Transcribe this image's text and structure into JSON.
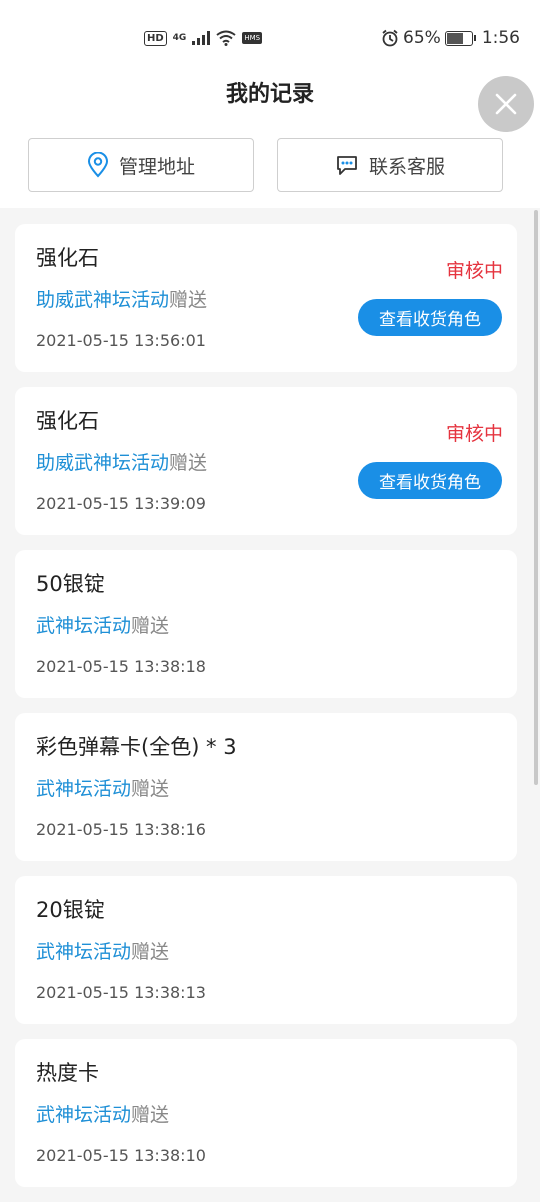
{
  "status_bar": {
    "hd": "HD",
    "network": "4G",
    "hms": "HMS",
    "battery_pct": "65%",
    "battery_level": 0.65,
    "time": "1:56"
  },
  "page": {
    "title": "我的记录"
  },
  "actions": {
    "address_label": "管理地址",
    "service_label": "联系客服"
  },
  "records": [
    {
      "name": "强化石",
      "source": "助威武神坛活动",
      "suffix": "赠送",
      "time": "2021-05-15 13:56:01",
      "status": "审核中",
      "button": "查看收货角色"
    },
    {
      "name": "强化石",
      "source": "助威武神坛活动",
      "suffix": "赠送",
      "time": "2021-05-15 13:39:09",
      "status": "审核中",
      "button": "查看收货角色"
    },
    {
      "name": "50银锭",
      "source": "武神坛活动",
      "suffix": "赠送",
      "time": "2021-05-15 13:38:18"
    },
    {
      "name": "彩色弹幕卡(全色) * 3",
      "source": "武神坛活动",
      "suffix": "赠送",
      "time": "2021-05-15 13:38:16"
    },
    {
      "name": "20银锭",
      "source": "武神坛活动",
      "suffix": "赠送",
      "time": "2021-05-15 13:38:13"
    },
    {
      "name": "热度卡",
      "source": "武神坛活动",
      "suffix": "赠送",
      "time": "2021-05-15 13:38:10"
    }
  ],
  "colors": {
    "link": "#1e8fd6",
    "status": "#e5343f",
    "primary_button": "#1a8fe6",
    "background": "#f5f5f5"
  },
  "icons": {
    "close": "close-icon",
    "address": "location-pin-icon",
    "service": "chat-bubble-icon"
  }
}
